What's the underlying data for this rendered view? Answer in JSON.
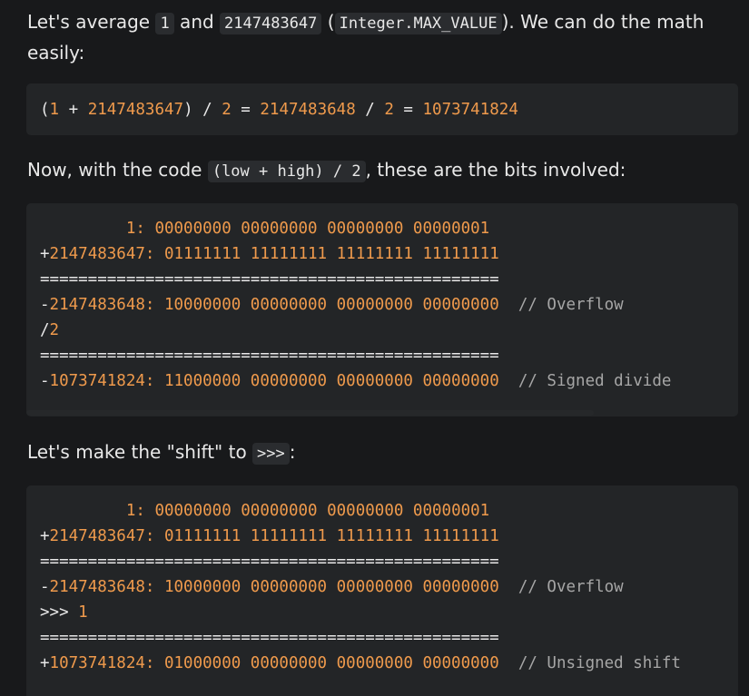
{
  "para1": {
    "t1": "Let's average ",
    "c1": "1",
    "t2": " and ",
    "c2": "2147483647",
    "t3": " (",
    "c3": "Integer.MAX_VALUE",
    "t4": "). We can do the math",
    "t5": "easily:"
  },
  "code1": {
    "open": "(",
    "n1": "1",
    "plus": " + ",
    "n2": "2147483647",
    "close_div": ") / ",
    "n3": "2",
    "eq1": " = ",
    "n4": "2147483648",
    "div2": " / ",
    "n5": "2",
    "eq2": " = ",
    "n6": "1073741824"
  },
  "para2": {
    "t1": "Now, with the code ",
    "c1": "(low + high) / 2",
    "t2": ", these are the bits involved:"
  },
  "code2": {
    "l1_pad": "         ",
    "l1_num": "1",
    "l1_colon": ": ",
    "l1_bits": "00000000 00000000 00000000 00000001",
    "l2_plus": "+",
    "l2_num": "2147483647",
    "l2_colon": ": ",
    "l2_bits": "01111111 11111111 11111111 11111111",
    "l3": "================================================",
    "l4_minus": "-",
    "l4_num": "2147483648",
    "l4_colon": ": ",
    "l4_bits": "10000000 00000000 00000000 00000000",
    "l4_comment": "  // Overflow",
    "l5_op": "/",
    "l5_num": "2",
    "l6": "================================================",
    "l7_minus": "-",
    "l7_num": "1073741824",
    "l7_colon": ": ",
    "l7_bits": "11000000 00000000 00000000 00000000",
    "l7_comment": "  // Signed divide"
  },
  "para3": {
    "t1": "Let's make the \"shift\" to ",
    "c1": ">>>",
    "t2": ":"
  },
  "code3": {
    "l1_pad": "         ",
    "l1_num": "1",
    "l1_colon": ": ",
    "l1_bits": "00000000 00000000 00000000 00000001",
    "l2_plus": "+",
    "l2_num": "2147483647",
    "l2_colon": ": ",
    "l2_bits": "01111111 11111111 11111111 11111111",
    "l3": "================================================",
    "l4_minus": "-",
    "l4_num": "2147483648",
    "l4_colon": ": ",
    "l4_bits": "10000000 00000000 00000000 00000000",
    "l4_comment": "  // Overflow",
    "l5_op": ">>> ",
    "l5_num": "1",
    "l6": "================================================",
    "l7_plus": "+",
    "l7_num": "1073741824",
    "l7_colon": ": ",
    "l7_bits": "01000000 00000000 00000000 00000000",
    "l7_comment": "  // Unsigned shift"
  },
  "colors": {
    "background": "#18191b",
    "code_background": "#232527",
    "number": "#ef9a4c",
    "comment": "#a6a6a6",
    "text": "#e8e8e8"
  }
}
